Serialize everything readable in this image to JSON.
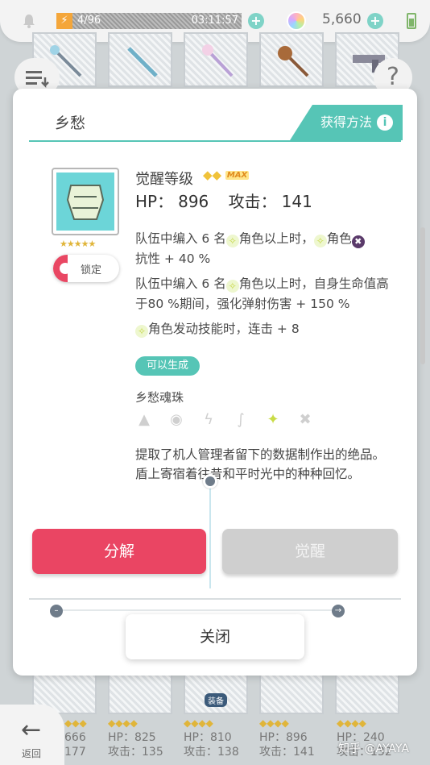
{
  "status_bar": {
    "stamina": "4/96",
    "timer": "03:11:57",
    "gems": "5,660",
    "plus": "+"
  },
  "dialog": {
    "title": "乡愁",
    "obtain_label": "获得方法",
    "info": "i",
    "stars": "★★★★★",
    "lock_label": "锁定",
    "awaken_label": "觉醒等级",
    "awaken_icons": "◆◆",
    "max_tag": "MAX",
    "hp_label": "HP：",
    "hp_value": "896",
    "atk_label": "攻击：",
    "atk_value": "141",
    "skill1_a": "队伍中编入 6 名",
    "skill1_b": "角色以上时，",
    "skill1_c": "角色",
    "skill1_d": "抗性 + 40 %",
    "skill2_a": "队伍中编入 6 名",
    "skill2_b": "角色以上时，自身生命值高于80 %期间，强化弹射伤害 + 150 %",
    "skill3": "角色发动技能时，连击 + 8",
    "gen_badge": "可以生成",
    "orb_name": "乡愁魂珠",
    "description": "提取了机人管理者留下的数据制作出的绝品。盾上寄宿着往昔和平时光中的种种回忆。",
    "decompose": "分解",
    "awaken": "觉醒",
    "close": "关闭"
  },
  "bottom": {
    "back_label": "返回",
    "items": [
      {
        "hp": "666",
        "atk": "177",
        "stars": "◆◆◆"
      },
      {
        "hp": "HP：825",
        "atk": "攻击：135",
        "stars": "◆◆◆◆"
      },
      {
        "hp": "HP：810",
        "atk": "攻击：138",
        "stars": "◆◆◆◆"
      },
      {
        "hp": "HP：896",
        "atk": "攻击：141",
        "stars": "◆◆◆◆"
      },
      {
        "hp": "HP：240",
        "atk": "攻击：132",
        "stars": "◆◆◆◆"
      }
    ],
    "equip_tag": "装备",
    "watermark": "知乎 @AYAYA"
  }
}
